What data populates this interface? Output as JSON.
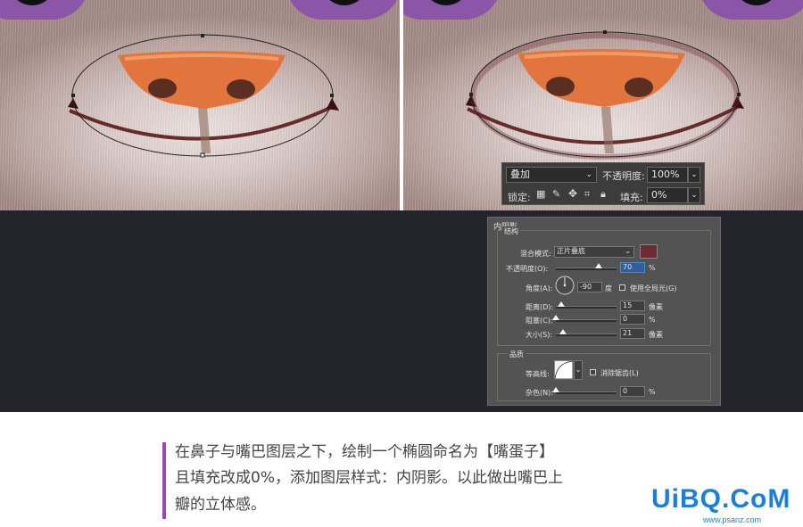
{
  "layer_bar": {
    "blend_mode": "叠加",
    "opacity_label": "不透明度:",
    "opacity_value": "100%",
    "lock_label": "锁定:",
    "fill_label": "填充:",
    "fill_value": "0%",
    "icons": [
      "lock-transparent-icon",
      "brush-icon",
      "move-icon",
      "crop-artboard-icon",
      "lock-icon"
    ]
  },
  "inner_shadow_panel": {
    "title": "内阴影",
    "structure_label": "结构",
    "blend_mode_label": "混合模式:",
    "blend_mode_value": "正片叠底",
    "shadow_color": "#6e2a30",
    "opacity_label": "不透明度(O):",
    "opacity_value": "70",
    "opacity_fraction": 0.7,
    "percent_unit": "%",
    "angle_label": "角度(A):",
    "angle_value": "-90",
    "degree_unit": "度",
    "global_light_label": "使用全局光(G)",
    "distance_label": "距离(D):",
    "distance_value": "15",
    "choke_label": "阻塞(C):",
    "choke_value": "0",
    "size_label": "大小(S):",
    "size_value": "21",
    "pixel_unit": "像素",
    "quality_label": "品质",
    "contour_label": "等高线:",
    "antialias_label": "消除锯齿(L)",
    "noise_label": "杂色(N):",
    "noise_value": "0"
  },
  "caption": {
    "line1": "在鼻子与嘴巴图层之下，绘制一个椭圆命名为【嘴蛋子】",
    "line2": "且填充改成0%，添加图层样式：内阴影。以此做出嘴巴上",
    "line3": "瓣的立体感。"
  },
  "watermark": {
    "text": "UiBQ.CoM",
    "url": "www.psanz.com"
  },
  "colors": {
    "accent": "#9b46c1",
    "nose": "#e2753e",
    "fur_purple": "#8b55a8",
    "dark_background": "#23242c"
  }
}
